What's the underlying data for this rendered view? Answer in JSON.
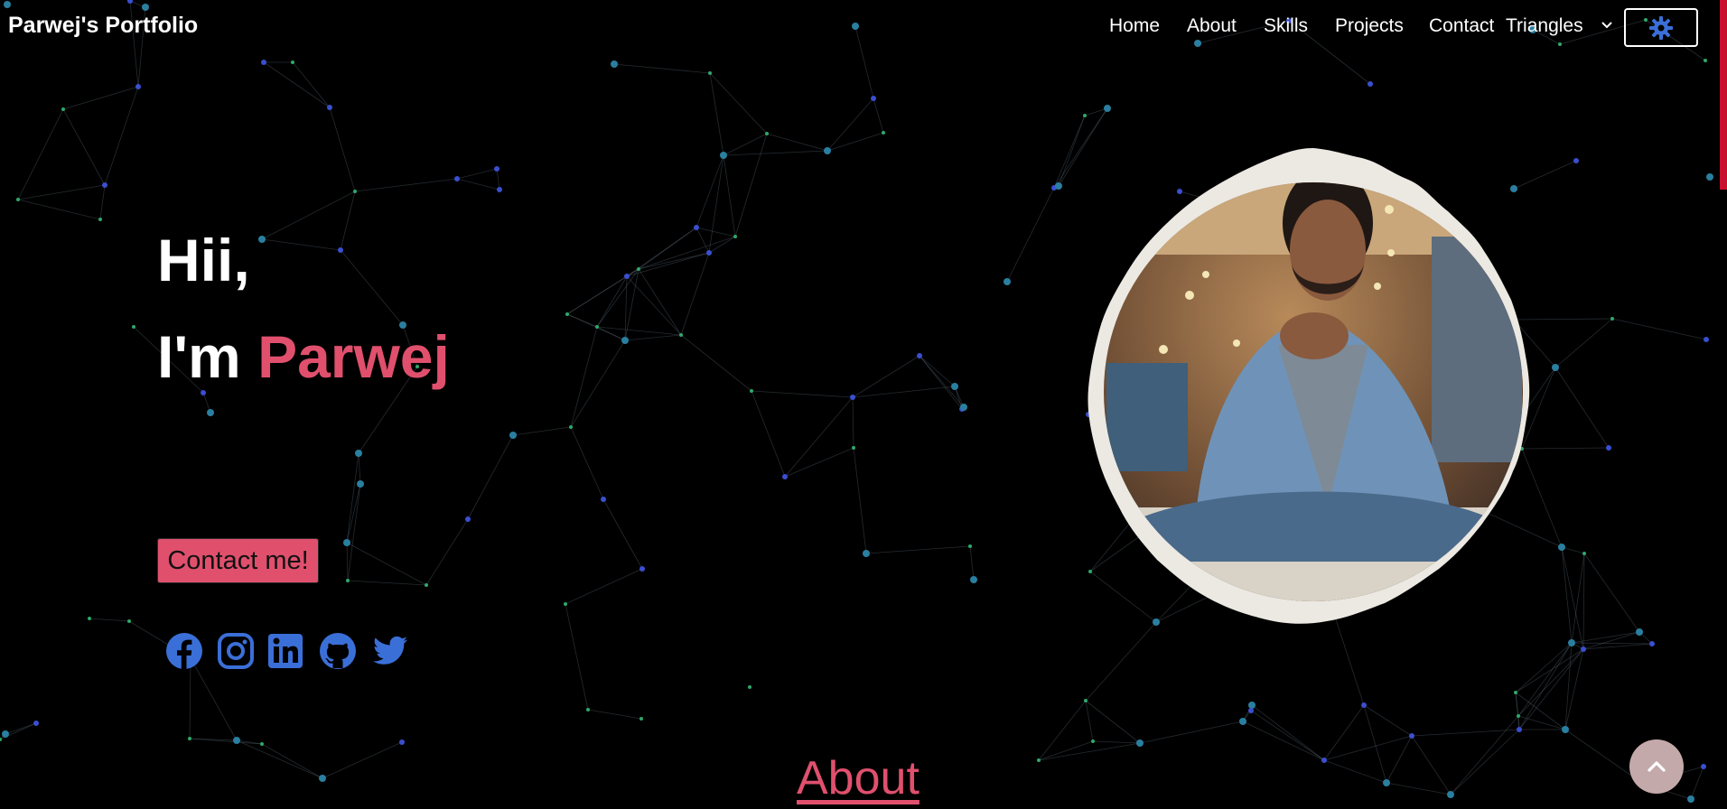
{
  "header": {
    "brand": "Parwej's Portfolio",
    "nav": [
      "Home",
      "About",
      "Skills",
      "Projects",
      "Contact"
    ],
    "background_select": {
      "selected": "Triangles"
    },
    "theme_toggle_icon": "gear-icon"
  },
  "hero": {
    "greeting": "Hii,",
    "intro_prefix": "I'm",
    "name": "Parwej",
    "contact_button": "Contact me!",
    "socials": [
      "facebook-icon",
      "instagram-icon",
      "linkedin-icon",
      "github-icon",
      "twitter-icon"
    ]
  },
  "about": {
    "heading": "About"
  },
  "scroll_top_icon": "chevron-up-icon",
  "colors": {
    "accent": "#e0506d",
    "social": "#3b6fd8",
    "background": "#000000",
    "scroll_top": "#c4a9ab",
    "particles": [
      "#2ea86a",
      "#3a4fd0",
      "#2a7fa0"
    ]
  }
}
